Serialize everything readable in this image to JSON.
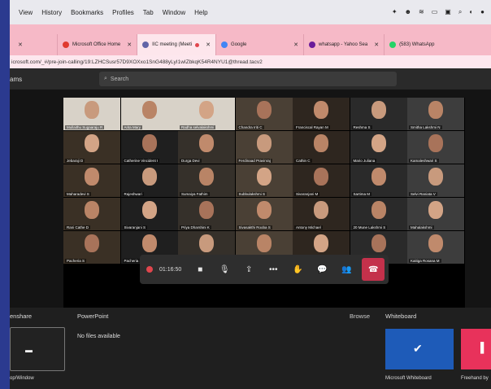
{
  "menubar": {
    "items": [
      "View",
      "History",
      "Bookmarks",
      "Profiles",
      "Tab",
      "Window",
      "Help"
    ]
  },
  "tabs": [
    {
      "label": "Microsoft Office Home",
      "color": "#e03a2f",
      "active": false
    },
    {
      "label": "IIC meeting (Meeti",
      "color": "#6264a7",
      "active": true
    },
    {
      "label": "Google",
      "color": "#4285f4",
      "active": false
    },
    {
      "label": "whatsapp - Yahoo Sea",
      "color": "#6a1b9a",
      "active": false
    },
    {
      "label": "(583) WhatsApp",
      "color": "#25d366",
      "active": false
    }
  ],
  "address": "icrosoft.com/_#/pre-join-calling/19:LZHCSusr57D9XOXxo1SnG488yLyI1wIZbkqK54R4NYU1@thread.tacv2",
  "teams": {
    "brand": "ams",
    "search_placeholder": "Search"
  },
  "participants": [
    "Mullaithu Sugaaraju R",
    "Arita Mary",
    "Radha selvalakshmi",
    "Chandra Iriti C",
    "Franciscal Rayan M",
    "Reshma S",
    "Smitha Lakshmi N",
    "Jebaraji D",
    "Catherine Vincident I",
    "Durga Devi",
    "Ferdinaad Pravinraj",
    "Cathin C",
    "Mario Juliana",
    "Kamaleshwari S",
    "Maharadevi S",
    "Rajeshwari",
    "Sumaiya Fathim",
    "Subbulakshmi S",
    "Sivaranjani M",
    "Sartima M",
    "Selvi Raniata V",
    "Rani Cathe D",
    "Sivaranjani S",
    "Priya Dharshini K",
    "Sivasakthi Rooba S",
    "Antony Michael",
    "20 Mune Lakshmi S",
    "Mahalakshmi",
    "Pacheria S",
    "Pacheria S",
    "",
    "",
    "",
    "",
    "Kaitiga Rosana M"
  ],
  "controls": {
    "timer": "01:16:50"
  },
  "bottom": {
    "screenshare_label": "enshare",
    "powerpoint_label": "PowerPoint",
    "browse_label": "Browse",
    "whiteboard_label": "Whiteboard",
    "no_files": "No files available",
    "window_caption": "op/Window",
    "wb1_caption": "Microsoft Whiteboard",
    "wb2_caption": "Freehand by"
  }
}
